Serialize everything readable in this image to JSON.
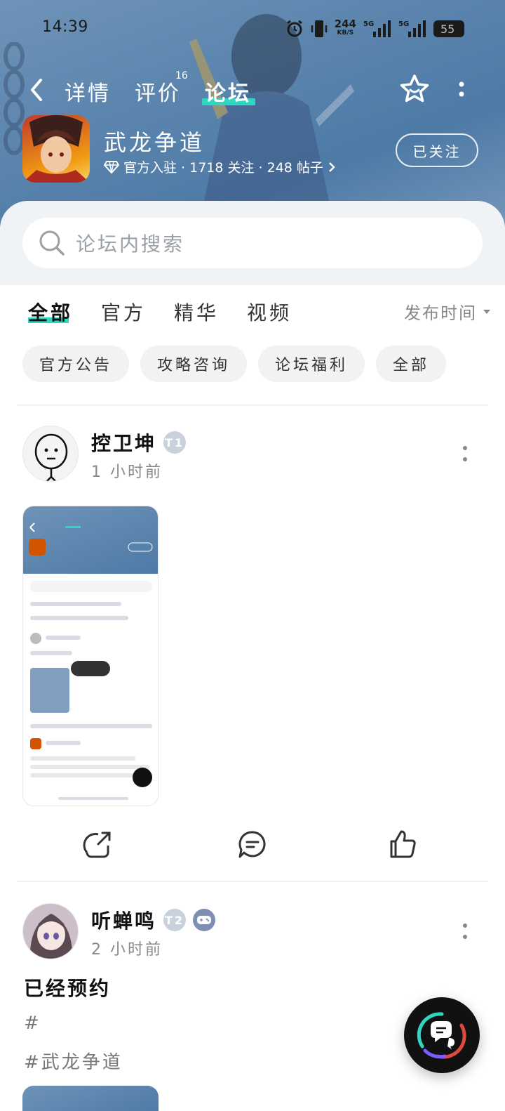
{
  "status_bar": {
    "time": "14:39",
    "net_speed": "244",
    "net_unit": "KB/S",
    "signal1": "5G",
    "signal2": "5G",
    "battery": "55"
  },
  "nav": {
    "tabs": [
      {
        "label": "详情"
      },
      {
        "label": "评价"
      },
      {
        "label": "论坛"
      }
    ],
    "active_tab": "论坛",
    "review_count": "16"
  },
  "game": {
    "name": "武龙争道",
    "meta": "官方入驻 · 1718 关注 · 248 帖子",
    "follow_label": "已关注"
  },
  "search": {
    "placeholder": "论坛内搜索"
  },
  "filter_tabs": [
    {
      "label": "全部"
    },
    {
      "label": "官方"
    },
    {
      "label": "精华"
    },
    {
      "label": "视频"
    }
  ],
  "sort_label": "发布时间",
  "chips": [
    {
      "label": "官方公告"
    },
    {
      "label": "攻略咨询"
    },
    {
      "label": "论坛福利"
    },
    {
      "label": "全部"
    }
  ],
  "posts": [
    {
      "username": "控卫坤",
      "level": "T1",
      "time": "1 小时前"
    },
    {
      "username": "听蝉鸣",
      "level": "T2",
      "time": "2 小时前",
      "text": "已经预约",
      "tag1": "#",
      "tag2": "#武龙争道"
    }
  ],
  "colors": {
    "accent": "#2ed7c2",
    "hero": "#5a84ad"
  }
}
